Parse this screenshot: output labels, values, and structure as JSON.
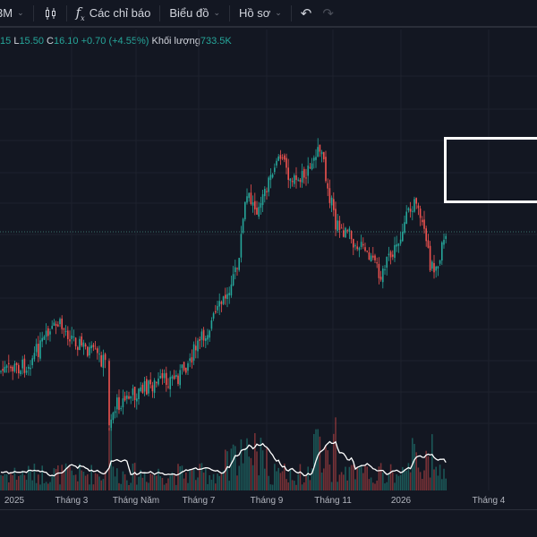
{
  "toolbar": {
    "interval": "3M",
    "indicators_label": "Các chỉ báo",
    "chart_label": "Biểu đồ",
    "profile_label": "Hồ sơ",
    "icons": [
      "chevron-down-icon",
      "candlestick-icon",
      "function-icon",
      "undo-icon",
      "redo-icon"
    ]
  },
  "legend": {
    "h_value": "15",
    "l_label": "L",
    "l_value": "15.50",
    "c_label": "C",
    "c_value": "16.10",
    "change": "+0.70 (+4.55%)",
    "volume_label": "Khối lượng",
    "volume_value": "733.5K"
  },
  "time_axis": [
    "2025",
    "Tháng 3",
    "Tháng Năm",
    "Tháng 7",
    "Tháng 9",
    "Tháng 11",
    "2026",
    "Tháng 4"
  ],
  "colors": {
    "up": "#26a69a",
    "down": "#ef5350",
    "background": "#131722",
    "volume_ma": "#ffffff"
  }
}
